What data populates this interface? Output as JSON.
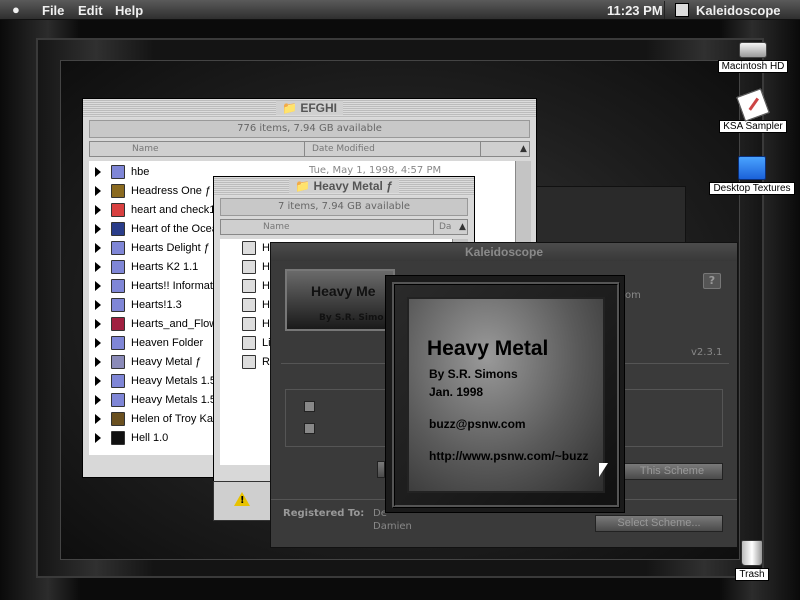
{
  "menubar": {
    "apple": "",
    "items": [
      "File",
      "Edit",
      "Help"
    ],
    "clock": "11:23 PM",
    "app_name": "Kaleidoscope"
  },
  "desktop_icons": [
    {
      "label": "Macintosh HD",
      "icon": "hard-disk-icon"
    },
    {
      "label": "KSA Sampler",
      "icon": "notepad-icon"
    },
    {
      "label": "Desktop Textures",
      "icon": "folder-icon"
    },
    {
      "label": "Trash",
      "icon": "trash-icon"
    }
  ],
  "efghi_window": {
    "title": "EFGHI",
    "info": "776 items, 7.94 GB available",
    "col_name": "Name",
    "col_date": "Date Modified",
    "first_row_date": "Tue, May 1, 1998, 4:57 PM",
    "rows": [
      {
        "name": "hbe",
        "color": "#7f86d6"
      },
      {
        "name": "Headress One ƒ",
        "color": "#8a6a20"
      },
      {
        "name": "heart and check1.",
        "color": "#d84040"
      },
      {
        "name": "Heart of the Ocean",
        "color": "#2a3d8a"
      },
      {
        "name": "Hearts Delight ƒ",
        "color": "#7f86d6"
      },
      {
        "name": "Hearts K2 1.1",
        "color": "#7f86d6"
      },
      {
        "name": "Hearts!! Informati",
        "color": "#7f86d6"
      },
      {
        "name": "Hearts!1.3",
        "color": "#7f86d6"
      },
      {
        "name": "Hearts_and_Flow",
        "color": "#a02040"
      },
      {
        "name": "Heaven Folder",
        "color": "#7f86d6"
      },
      {
        "name": "Heavy Metal ƒ",
        "color": "#8a8ab8"
      },
      {
        "name": "Heavy Metals 1.5",
        "color": "#7f86d6"
      },
      {
        "name": "Heavy Metals 1.5",
        "color": "#7f86d6"
      },
      {
        "name": "Helen of Troy Kal",
        "color": "#6a5020"
      },
      {
        "name": "Hell 1.0",
        "color": "#111111"
      }
    ]
  },
  "heavymetal_window": {
    "title": "Heavy Metal ƒ",
    "info": "7 items, 7.94 GB available",
    "col_name": "Name",
    "col_d": "Da",
    "rows": [
      "He",
      "He",
      "He",
      "He",
      "He",
      "Li",
      "Re"
    ]
  },
  "kaleidoscope_panel": {
    "title": "Kaleidoscope",
    "badge_title": "Heavy Me",
    "badge_by": "By S.R. Simo",
    "om_fragment": "om",
    "version": "v2.3.1",
    "help_label": "?",
    "button_scheme": "This Scheme",
    "registered_label": "Registered To:",
    "reg_line1": "De",
    "reg_line2": "Damien",
    "select_button": "Select Scheme..."
  },
  "about_box": {
    "title": "Heavy Metal",
    "by": "By S.R. Simons",
    "date": "Jan. 1998",
    "email": "buzz@psnw.com",
    "url": "http://www.psnw.com/~buzz"
  }
}
